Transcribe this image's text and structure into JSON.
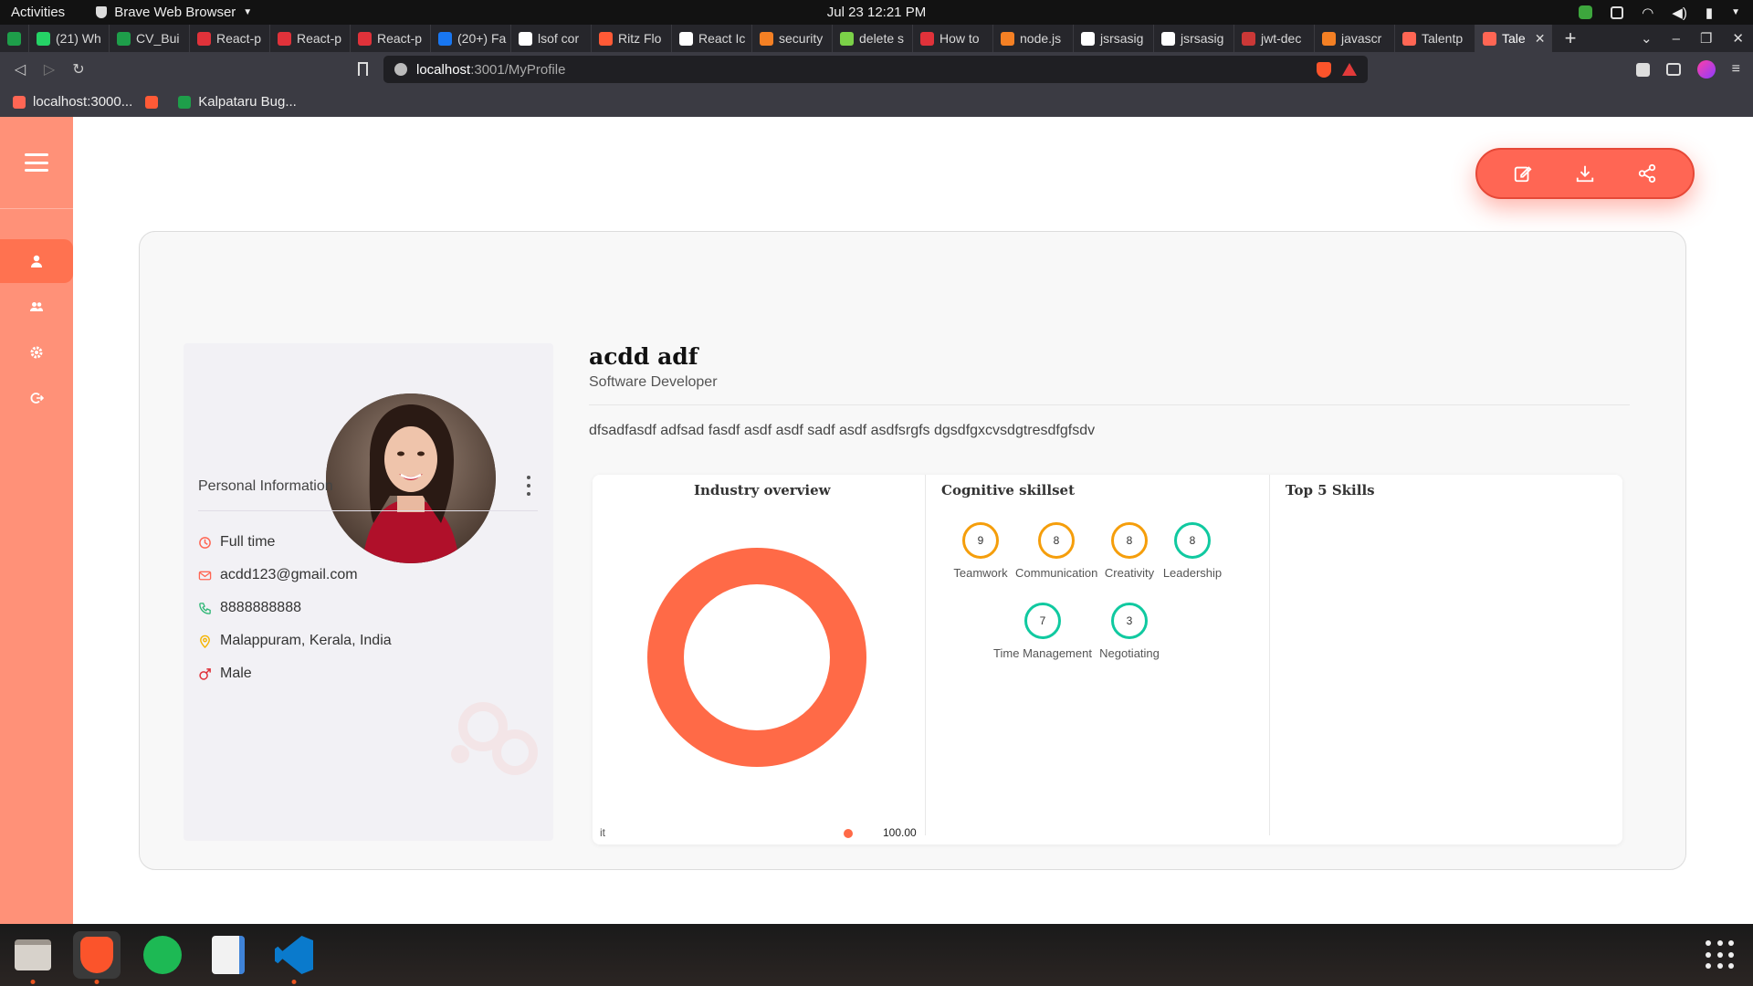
{
  "system": {
    "activities": "Activities",
    "app_name": "Brave Web Browser",
    "clock": "Jul 23  12:21 PM"
  },
  "browser": {
    "tabs": [
      {
        "label": "",
        "color": "#1e9e4a"
      },
      {
        "label": "(21) Wh",
        "color": "#25d366"
      },
      {
        "label": "CV_Bui",
        "color": "#1e9e4a"
      },
      {
        "label": "React-p",
        "color": "#e0323a"
      },
      {
        "label": "React-p",
        "color": "#e0323a"
      },
      {
        "label": "React-p",
        "color": "#e0323a"
      },
      {
        "label": "(20+) Fa",
        "color": "#1877f2"
      },
      {
        "label": "lsof cor",
        "color": "#ffffff"
      },
      {
        "label": "Ritz Flo",
        "color": "#ff5a36"
      },
      {
        "label": "React Ic",
        "color": "#ffffff"
      },
      {
        "label": "security",
        "color": "#f48024"
      },
      {
        "label": "delete s",
        "color": "#7bd148"
      },
      {
        "label": "How to",
        "color": "#e0323a"
      },
      {
        "label": "node.js",
        "color": "#f48024"
      },
      {
        "label": "jsrsasig",
        "color": "#ffffff"
      },
      {
        "label": "jsrsasig",
        "color": "#ffffff"
      },
      {
        "label": "jwt-dec",
        "color": "#cb3837"
      },
      {
        "label": "javascr",
        "color": "#f48024"
      },
      {
        "label": "Talentp",
        "color": "#ff6654"
      }
    ],
    "active_tab": {
      "label": "Tale",
      "color": "#ff6654"
    },
    "url_host": "localhost",
    "url_path": ":3001/MyProfile",
    "bookmarks": [
      {
        "label": "localhost:3000...",
        "color": "#ff6654"
      },
      {
        "label": "",
        "color": "#ff5a36"
      },
      {
        "label": "Kalpataru Bug...",
        "color": "#1e9e4a"
      }
    ]
  },
  "profile": {
    "name": "acdd adf",
    "role": "Software Developer",
    "bio": "dfsadfasdf adfsad fasdf asdf asdf sadf asdf asdfsrgfs dgsdfgxcvsdgtresdfgfsdv",
    "info_title": "Personal Information",
    "info": [
      {
        "icon": "job-type-icon",
        "text": "Full time",
        "color": "#ff6654"
      },
      {
        "icon": "mail-icon",
        "text": "acdd123@gmail.com",
        "color": "#ff6654"
      },
      {
        "icon": "phone-icon",
        "text": "8888888888",
        "color": "#2bb673"
      },
      {
        "icon": "location-icon",
        "text": "Malappuram, Kerala, India",
        "color": "#f5b400"
      },
      {
        "icon": "male-icon",
        "text": "Male",
        "color": "#e0323a"
      }
    ]
  },
  "panels": {
    "industry_title": "Industry overview",
    "cognitive_title": "Cognitive skillset",
    "top_skills_title": "Top 5 Skills"
  },
  "chart_data": {
    "type": "pie",
    "title": "Industry overview",
    "categories": [
      "it"
    ],
    "values": [
      100.0
    ],
    "value_labels": [
      "100.00"
    ],
    "colors": [
      "#ff6a47"
    ],
    "donut": true,
    "legend": "bottom"
  },
  "skills": [
    {
      "name": "Teamwork",
      "score": "9",
      "color": "#f59e0b"
    },
    {
      "name": "Communication",
      "score": "8",
      "color": "#f59e0b"
    },
    {
      "name": "Creativity",
      "score": "8",
      "color": "#f59e0b"
    },
    {
      "name": "Leadership",
      "score": "8",
      "color": "#10c9a0"
    },
    {
      "name": "Time Management",
      "score": "7",
      "color": "#10c9a0"
    },
    {
      "name": "Negotiating",
      "score": "3",
      "color": "#10c9a0"
    }
  ],
  "icons": {
    "menu": "hamburger-icon",
    "nav": [
      "user-icon",
      "users-icon",
      "gear-icon",
      "logout-icon"
    ],
    "actions": [
      "edit-icon",
      "download-icon",
      "share-icon"
    ]
  },
  "colors": {
    "sidebar": "#ff9178",
    "accent": "#ff6654"
  }
}
